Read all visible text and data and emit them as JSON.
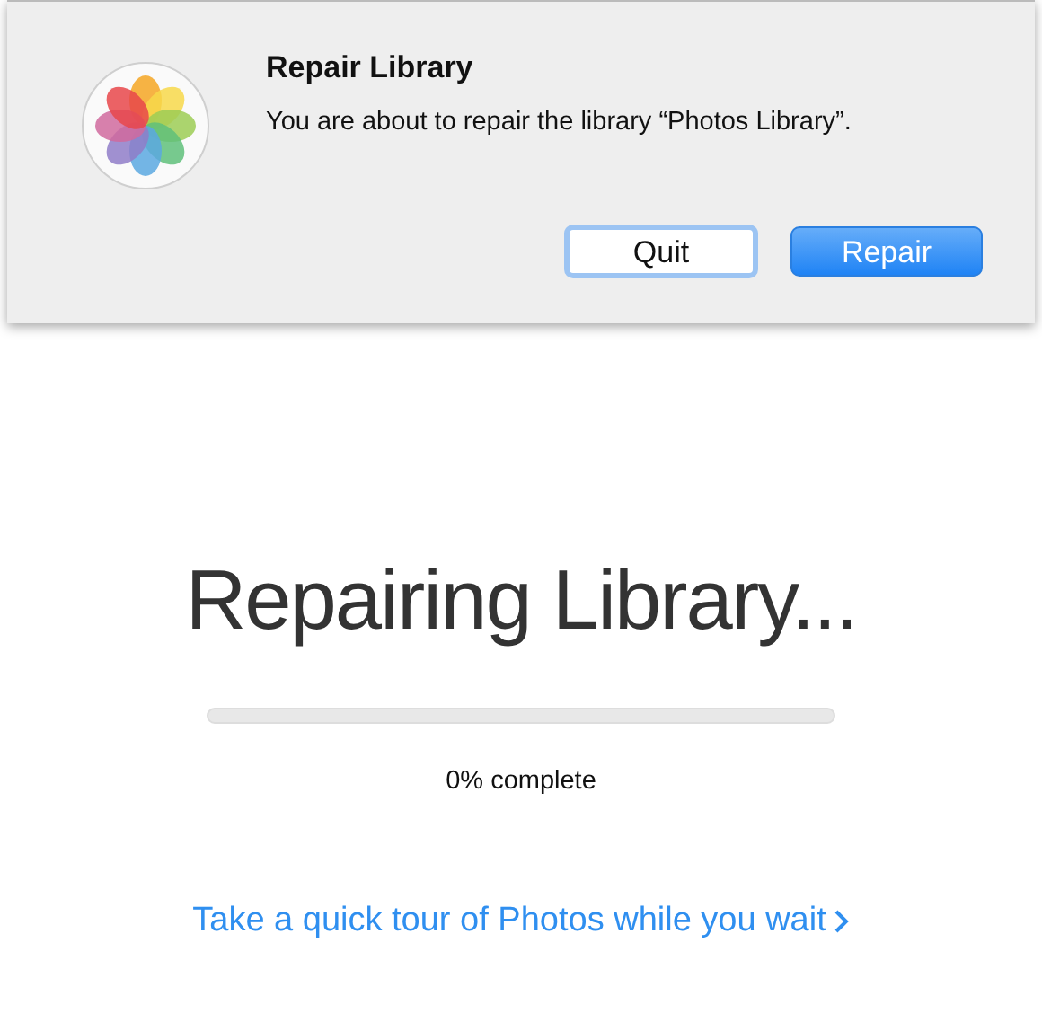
{
  "dialog": {
    "title": "Repair Library",
    "message": "You are about to repair the library “Photos Library”.",
    "buttons": [
      {
        "label": "Quit",
        "kind": "default"
      },
      {
        "label": "Repair",
        "kind": "primary"
      }
    ]
  },
  "main": {
    "heading": "Repairing Library...",
    "progress": {
      "level": 0
    },
    "status": "0% complete",
    "link": "Take a quick tour of Photos while you wait"
  }
}
